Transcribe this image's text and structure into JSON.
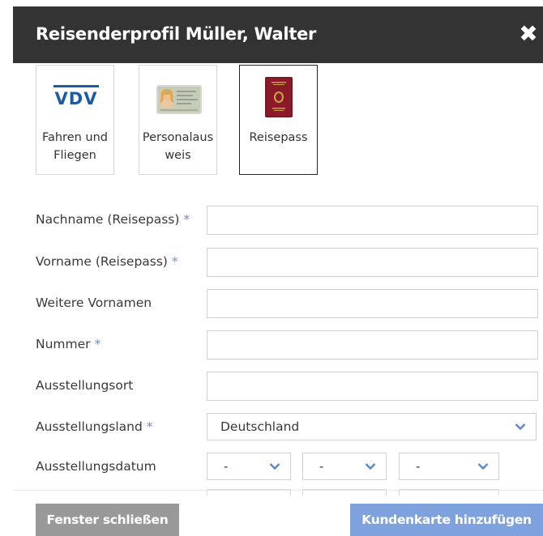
{
  "dialog": {
    "title": "Reisenderprofil Müller, Walter",
    "close_icon": "close-icon"
  },
  "tabs": [
    {
      "label": "Fahren und Fliegen",
      "logo_text": "VDV",
      "icon": "vdv-logo-icon",
      "active": false
    },
    {
      "label": "Personalausweis",
      "icon": "id-card-icon",
      "active": false
    },
    {
      "label": "Reisepass",
      "icon": "passport-icon",
      "active": true
    }
  ],
  "form": {
    "required_marker": "*",
    "fields": [
      {
        "label": "Nachname (Reisepass)",
        "required": true,
        "type": "text",
        "value": ""
      },
      {
        "label": "Vorname (Reisepass)",
        "required": true,
        "type": "text",
        "value": ""
      },
      {
        "label": "Weitere Vornamen",
        "required": false,
        "type": "text",
        "value": ""
      },
      {
        "label": "Nummer",
        "required": true,
        "type": "text",
        "value": ""
      },
      {
        "label": "Ausstellungsort",
        "required": false,
        "type": "text",
        "value": ""
      },
      {
        "label": "Ausstellungsland",
        "required": true,
        "type": "select",
        "value": "Deutschland"
      },
      {
        "label": "Ausstellungsdatum",
        "required": false,
        "type": "date",
        "day": "-",
        "month": "-",
        "year": "-"
      }
    ]
  },
  "buttons": {
    "close": "Fenster schließen",
    "add": "Kundenkarte hinzufügen"
  },
  "colors": {
    "header_bg": "#333333",
    "required": "#6a8fd4",
    "primary_button": "#7ea2de",
    "secondary_button": "#999999",
    "chevron": "#5b86d6"
  }
}
